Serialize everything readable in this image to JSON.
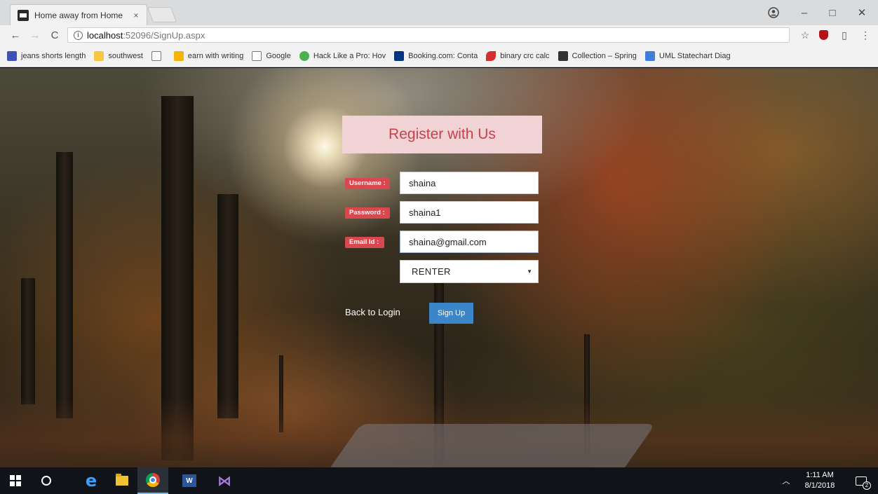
{
  "browser": {
    "tab_title": "Home away from Home",
    "tab_close": "×",
    "url_host": "localhost",
    "url_rest": ":52096/SignUp.aspx",
    "window_controls": {
      "min": "–",
      "max": "□",
      "close": "✕"
    }
  },
  "bookmarks": [
    {
      "label": "jeans shorts length",
      "icon": "flag-icon",
      "color": "#3f51b5"
    },
    {
      "label": "southwest",
      "icon": "folder-icon",
      "color": "#f6c744"
    },
    {
      "label": "",
      "icon": "page-icon",
      "color": "#ffffff"
    },
    {
      "label": "earn with writing",
      "icon": "note-icon",
      "color": "#f4b400"
    },
    {
      "label": "Google",
      "icon": "page-icon",
      "color": "#ffffff"
    },
    {
      "label": "Hack Like a Pro: Hov",
      "icon": "shield-icon",
      "color": "#4caf50"
    },
    {
      "label": "Booking.com: Conta",
      "icon": "booking-icon",
      "color": "#003580"
    },
    {
      "label": "binary crc calc",
      "icon": "binary-icon",
      "color": "#d32f2f"
    },
    {
      "label": "Collection – Spring",
      "icon": "collection-icon",
      "color": "#333333"
    },
    {
      "label": "UML Statechart Diag",
      "icon": "uml-icon",
      "color": "#3f7fd8"
    }
  ],
  "form": {
    "heading": "Register with Us",
    "username_label": "Username :",
    "username_value": "shaina",
    "password_label": "Password :",
    "password_value": "shaina1",
    "email_label": "Email Id :",
    "email_value": "shaina@gmail.com",
    "role_value": "RENTER",
    "back_link": "Back to Login",
    "signup_button": "Sign Up"
  },
  "colors": {
    "heading_bg": "#f2d3d5",
    "heading_text": "#c9414a",
    "label_bg": "#d9474f",
    "button_bg": "#3a86c8"
  },
  "taskbar": {
    "time": "1:11 AM",
    "date": "8/1/2018",
    "notification_count": "2"
  }
}
